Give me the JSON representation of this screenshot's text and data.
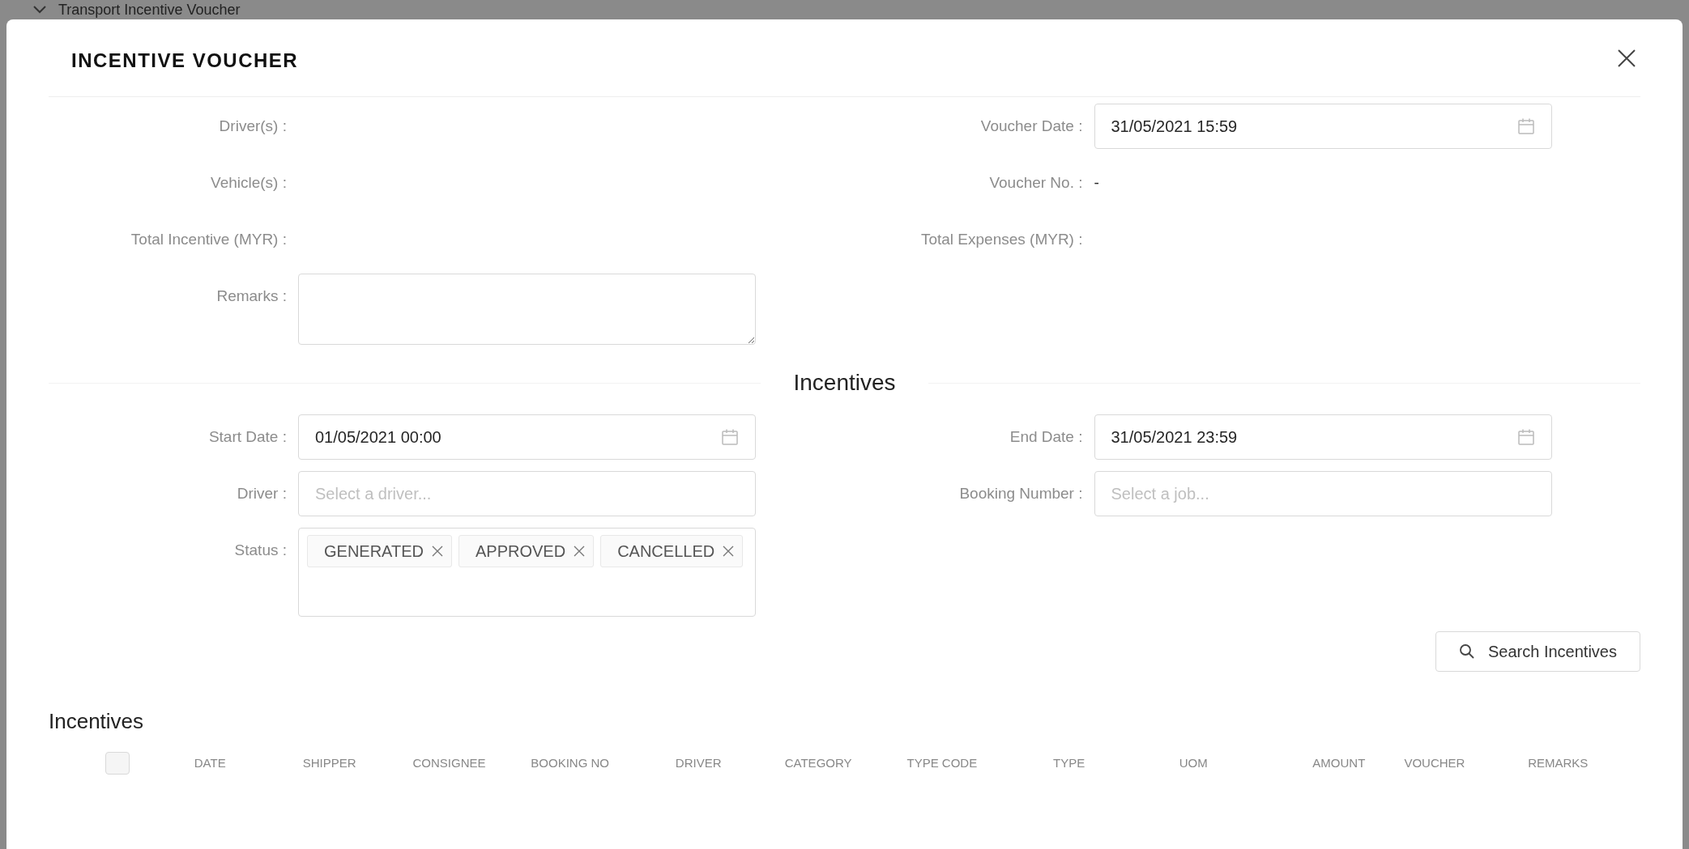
{
  "background": {
    "title": "Transport Incentive Voucher"
  },
  "modal": {
    "title": "INCENTIVE VOUCHER"
  },
  "details": [
    {
      "kind": "text",
      "label": "Driver(s) :"
    },
    {
      "kind": "date",
      "label": "Voucher Date :",
      "value": "31/05/2021 15:59"
    },
    {
      "kind": "text",
      "label": "Vehicle(s) :"
    },
    {
      "kind": "text",
      "label": "Voucher No. :",
      "value": "-"
    },
    {
      "kind": "text",
      "label": "Total Incentive (MYR) :"
    },
    {
      "kind": "text",
      "label": "Total Expenses (MYR) :"
    },
    {
      "kind": "textarea",
      "label": "Remarks :"
    }
  ],
  "section_title": "Incentives",
  "filters": [
    {
      "kind": "date",
      "label": "Start Date :",
      "value": "01/05/2021 00:00"
    },
    {
      "kind": "date",
      "label": "End Date :",
      "value": "31/05/2021 23:59"
    },
    {
      "kind": "select",
      "label": "Driver :",
      "placeholder": "Select a driver..."
    },
    {
      "kind": "select",
      "label": "Booking Number :",
      "placeholder": "Select a job..."
    },
    {
      "kind": "tags",
      "label": "Status :",
      "tags": [
        "GENERATED",
        "APPROVED",
        "CANCELLED"
      ]
    }
  ],
  "search_button": "Search Incentives",
  "table": {
    "title": "Incentives",
    "select_all": {
      "checked": false
    },
    "columns": [
      "DATE",
      "SHIPPER",
      "CONSIGNEE",
      "BOOKING NO",
      "DRIVER",
      "CATEGORY",
      "TYPE CODE",
      "TYPE",
      "UOM",
      "AMOUNT",
      "VOUCHER",
      "REMARKS"
    ]
  }
}
